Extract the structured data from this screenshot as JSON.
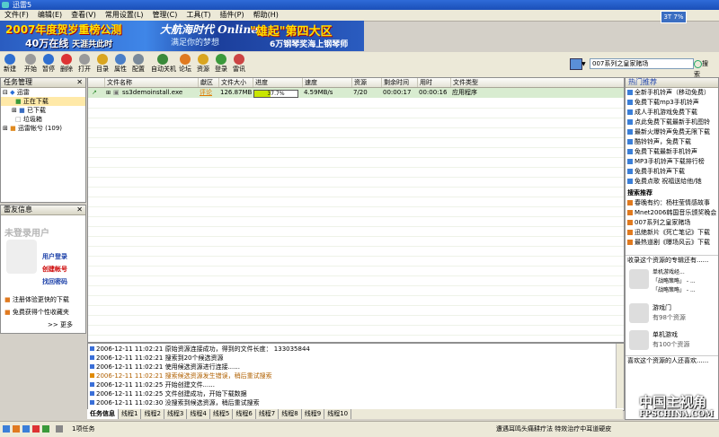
{
  "window": {
    "title": "迅雷5"
  },
  "menu": [
    "文件(F)",
    "编辑(E)",
    "查看(V)",
    "常用设置(L)",
    "管理(C)",
    "工具(T)",
    "插件(P)",
    "帮助(H)"
  ],
  "speed_indicator": "3T 7%",
  "banner": {
    "left_line1": "2007年度贺岁重榜公测",
    "left_line2": "40万在线",
    "left_line2_sub": "天涯共此时",
    "mid_title": "大航海时代 Online",
    "mid_sub": "满足你的梦想",
    "right_line1": "\"雄起\"第四大区",
    "right_line2": "6万钢琴奖海上钢琴师"
  },
  "toolbar": {
    "buttons": [
      {
        "label": "新建",
        "color": "#2f6fd0"
      },
      {
        "label": "开始",
        "color": "#9a9a9a"
      },
      {
        "label": "暂停",
        "color": "#2f6fd0"
      },
      {
        "label": "删除",
        "color": "#d33"
      },
      {
        "label": "打开",
        "color": "#9a9a9a"
      },
      {
        "label": "目录",
        "color": "#d9a520"
      },
      {
        "label": "属性",
        "color": "#4a7fc8"
      },
      {
        "label": "配置",
        "color": "#7a8a9a"
      },
      {
        "label": "自动关机",
        "color": "#3a8a3a"
      },
      {
        "label": "论坛",
        "color": "#e07a20"
      },
      {
        "label": "资源",
        "color": "#d9a520"
      },
      {
        "label": "登录",
        "color": "#3b9a3b"
      },
      {
        "label": "雷讯",
        "color": "#c44"
      }
    ],
    "search_value": "007系列之皇家赌场",
    "search_button": "搜索"
  },
  "task_panel": {
    "title": "任务管理",
    "tree": [
      "迅雷",
      "正在下载",
      "已下载",
      "垃圾箱",
      "迅雷帐兮 (109)"
    ]
  },
  "friend_panel": {
    "title": "雷友信息",
    "guest": "未登录用户",
    "links": [
      "用户登录",
      "创建帐号",
      "找回密码"
    ],
    "promos": [
      "注册体验更快的下载",
      "免费获得个性收藏夹"
    ],
    "more": ">> 更多"
  },
  "list": {
    "columns": [
      "文件名称",
      "獻区",
      "文件大小",
      "进度",
      "速度",
      "资源",
      "剩余时间",
      "用时",
      "文件类型"
    ],
    "rows": [
      {
        "name": "ss3demoinstall.exe",
        "zone": "评论",
        "size": "126.87MB",
        "progress_pct": 37.7,
        "progress_text": "37.7%",
        "speed": "4.59MB/s",
        "sources": "7/20",
        "remaining": "00:00:17",
        "elapsed": "00:00:16",
        "type": "应用程序"
      }
    ]
  },
  "log": [
    {
      "text": "2006-12-11 11:02:21  原始资源连接成功，得到的文件长度：  133035844",
      "color": "#000"
    },
    {
      "text": "2006-12-11 11:02:21  搜索到20个候选资源",
      "color": "#000"
    },
    {
      "text": "2006-12-11 11:02:21  使用候选资源进行连接......",
      "color": "#000"
    },
    {
      "text": "2006-12-11 11:02:21  搜索候选资源发生错误，稍后重试搜索",
      "color": "#b06000"
    },
    {
      "text": "2006-12-11 11:02:25  开始创建文件......",
      "color": "#000"
    },
    {
      "text": "2006-12-11 11:02:25  文件创建成功，开始下载数据",
      "color": "#000"
    },
    {
      "text": "2006-12-11 11:02:30  没搜索到候选资源，稍后重试搜索",
      "color": "#000"
    }
  ],
  "tabs": [
    "任务信息",
    "线程1",
    "线程2",
    "线程3",
    "线程4",
    "线程5",
    "线程6",
    "线程7",
    "线程8",
    "线程9",
    "线程10"
  ],
  "right_panel": {
    "title": "热门推荐",
    "hot": [
      "全新手机铃声（移动免费）",
      "免费下载mp3手机铃声",
      "成人手机游戏免费下载",
      "点此免费下载最新手机图铃",
      "最新火爆铃声免费无限下载",
      "酷铃铃声，免费下载",
      "免费下载最新手机铃声",
      "MP3手机铃声下载排行榜",
      "免费手机铃声下载",
      "免费点歌 祝福送给他/她"
    ],
    "search_title": "搜索推荐",
    "search": [
      "春晚有约：杨柱莹情感故事",
      "Mnet2006韩国音乐颁奖晚会",
      "007系列之皇家赌场",
      "迅绝新片《死亡笔记》下载",
      "最热道剧《曝场风云》下载"
    ],
    "collect_title": "收录这个资源的专辑还有......",
    "albums": [
      {
        "name": "游戏门",
        "count": "有98个资源"
      },
      {
        "name": "单机游戏",
        "count": "有100个资源"
      }
    ],
    "album_sub": [
      "单机游戏经...",
      "「战略策略」 - ...",
      "「战略策略」 - ..."
    ],
    "also_title": "喜欢这个资源的人还喜欢......"
  },
  "status": {
    "count": "1项任务",
    "right_text": "遭遇耳鸣头痛耕疗法 特效治疗中耳道硬皮"
  },
  "watermark": {
    "line1": "中国主视角",
    "line2": "FPSCHINA.COM"
  }
}
